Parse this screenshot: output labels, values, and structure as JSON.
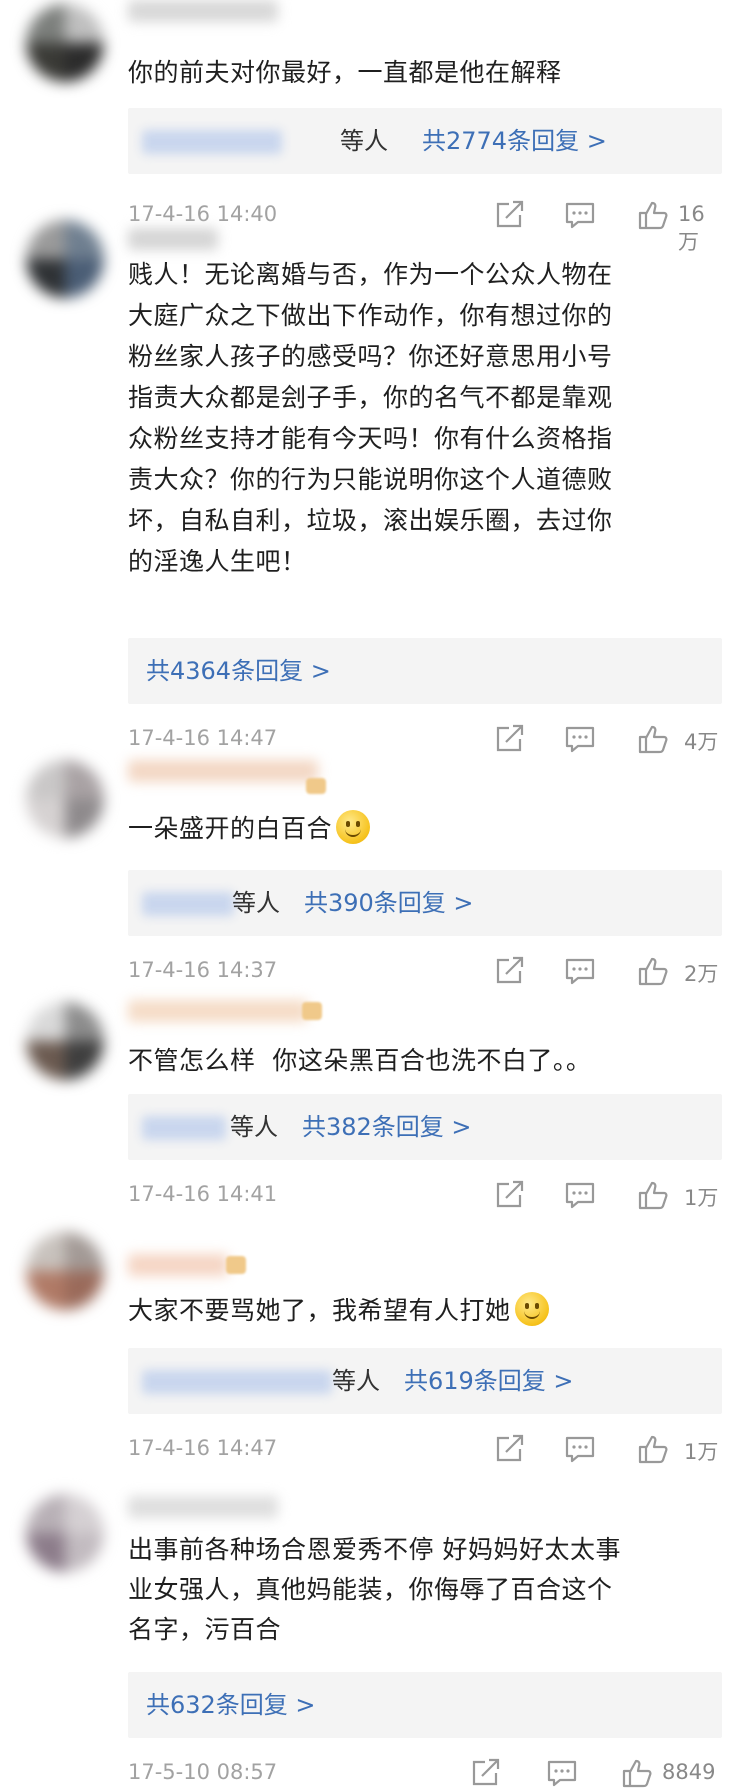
{
  "colors": {
    "link": "#3d6fb6",
    "timestamp": "#a2a2a2",
    "reply_bg": "#f4f4f4"
  },
  "icons": {
    "share": "share-icon",
    "comment": "comment-icon",
    "like": "thumbs-up-icon",
    "emoji": "smile-emoji-icon",
    "badge": "crown-badge-icon"
  },
  "comments": [
    {
      "body": "你的前夫对你最好，一直都是他在解释",
      "reply_prefix": "等人",
      "reply_count": "共2774条回复 >",
      "timestamp": "17-4-16 14:40",
      "likes": "16万"
    },
    {
      "body": "贱人！无论离婚与否，作为一个公众人物在\n大庭广众之下做出下作动作，你有想过你的\n粉丝家人孩子的感受吗？你还好意思用小号\n指责大众都是刽子手，你的名气不都是靠观\n众粉丝支持才能有今天吗！你有什么资格指\n责大众？你的行为只能说明你这个人道德败\n坏，自私自利，垃圾，滚出娱乐圈，去过你\n的淫逸人生吧！",
      "reply_prefix": "",
      "reply_count": "共4364条回复 >",
      "timestamp": "17-4-16 14:47",
      "likes": "4万"
    },
    {
      "body": "一朵盛开的白百合",
      "reply_prefix": "等人",
      "reply_count": "共390条回复 >",
      "timestamp": "17-4-16 14:37",
      "likes": "2万"
    },
    {
      "body": "不管怎么样  你这朵黑百合也洗不白了。。",
      "reply_prefix": "等人",
      "reply_count": "共382条回复 >",
      "timestamp": "17-4-16 14:41",
      "likes": "1万"
    },
    {
      "body": "大家不要骂她了，我希望有人打她",
      "reply_prefix": "等人",
      "reply_count": "共619条回复 >",
      "timestamp": "17-4-16 14:47",
      "likes": "1万"
    },
    {
      "body": "出事前各种场合恩爱秀不停 好妈妈好太太事\n业女强人，真他妈能装，你侮辱了百合这个\n名字，污百合",
      "reply_prefix": "",
      "reply_count": "共632条回复 >",
      "timestamp": "17-5-10 08:57",
      "likes": "8849"
    }
  ]
}
